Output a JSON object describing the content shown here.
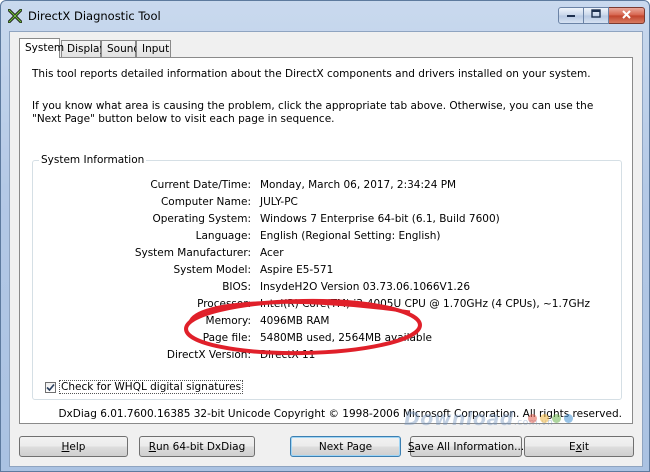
{
  "window": {
    "title": "DirectX Diagnostic Tool"
  },
  "tabs": [
    {
      "label": "System",
      "active": true
    },
    {
      "label": "Display",
      "active": false
    },
    {
      "label": "Sound",
      "active": false
    },
    {
      "label": "Input",
      "active": false
    }
  ],
  "intro": {
    "line1": "This tool reports detailed information about the DirectX components and drivers installed on your system.",
    "line2": "If you know what area is causing the problem, click the appropriate tab above.  Otherwise, you can use the \"Next Page\" button below to visit each page in sequence."
  },
  "system_info": {
    "title": "System Information",
    "rows": [
      {
        "label": "Current Date/Time:",
        "value": "Monday, March 06, 2017, 2:34:24 PM"
      },
      {
        "label": "Computer Name:",
        "value": "JULY-PC"
      },
      {
        "label": "Operating System:",
        "value": "Windows 7 Enterprise 64-bit (6.1, Build 7600)"
      },
      {
        "label": "Language:",
        "value": "English (Regional Setting: English)"
      },
      {
        "label": "System Manufacturer:",
        "value": "Acer"
      },
      {
        "label": "System Model:",
        "value": "Aspire E5-571"
      },
      {
        "label": "BIOS:",
        "value": "InsydeH2O Version 03.73.06.1066V1.26"
      },
      {
        "label": "Processor:",
        "value": "Intel(R) Core(TM) i3-4005U CPU @ 1.70GHz (4 CPUs), ~1.7GHz"
      },
      {
        "label": "Memory:",
        "value": "4096MB RAM"
      },
      {
        "label": "Page file:",
        "value": "5480MB used, 2564MB available"
      },
      {
        "label": "DirectX Version:",
        "value": "DirectX 11"
      }
    ]
  },
  "whql": {
    "label": "Check for WHQL digital signatures",
    "checked": true
  },
  "footer_info": "DxDiag 6.01.7600.16385 32-bit Unicode  Copyright © 1998-2006 Microsoft Corporation.  All rights reserved.",
  "buttons": {
    "help": "Help",
    "run64": "Run 64-bit DxDiag",
    "next": "Next Page",
    "save_all": "Save All Information...",
    "exit": "Exit"
  },
  "watermark": {
    "text": "Download",
    "suffix": ".com.vn"
  },
  "colors": {
    "annotation": "#e0202a",
    "accent": "#3c7fb1"
  },
  "icons": {
    "app": "directx-icon",
    "minimize": "minimize-icon",
    "maximize": "maximize-icon",
    "close": "close-icon"
  }
}
